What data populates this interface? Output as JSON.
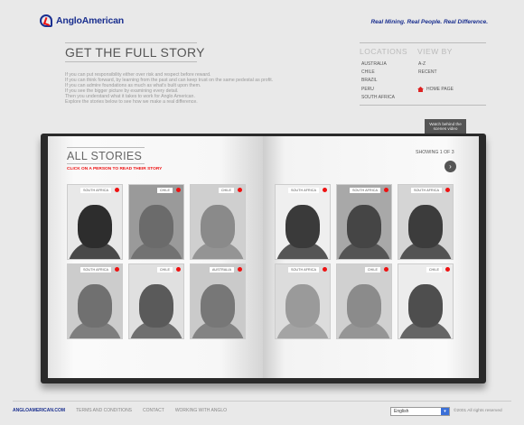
{
  "header": {
    "logo_text": "AngloAmerican",
    "tagline": "Real Mining. Real People. Real Difference."
  },
  "hero": {
    "title": "GET THE FULL STORY",
    "intro": [
      "If you can put responsibility either over risk and respect before reward.",
      "If you can think forward, by learning from the past and can keep trust on the same pedestal as profit.",
      "If you can admire foundations as much as what's built upon them.",
      "If you see the bigger picture by examining every detail.",
      "Then you understand what it takes to work for Anglo American.",
      "Explore the stories below to see how we make a real difference."
    ]
  },
  "nav": {
    "locations_label": "LOCATIONS",
    "locations": [
      "AUSTRALIA",
      "CHILE",
      "BRAZIL",
      "PERU",
      "SOUTH AFRICA"
    ],
    "view_by_label": "VIEW BY",
    "view_by": [
      "A-Z",
      "RECENT"
    ],
    "home_label": "HOME PAGE"
  },
  "video_button": "Watch behind the scenes video",
  "stories": {
    "title": "ALL STORIES",
    "hint": "CLICK ON A PERSON TO READ THEIR STORY",
    "showing": "SHOWING 1 OF 3",
    "next_symbol": "›",
    "people": [
      {
        "location": "SOUTH AFRICA",
        "skin": "#2d2d2d",
        "bg": "#e8e8e8"
      },
      {
        "location": "CHILE",
        "skin": "#6b6b6b",
        "bg": "#9a9a9a"
      },
      {
        "location": "CHILE",
        "skin": "#8a8a8a",
        "bg": "#cfcfcf"
      },
      {
        "location": "SOUTH AFRICA",
        "skin": "#3a3a3a",
        "bg": "#efefef"
      },
      {
        "location": "SOUTH AFRICA",
        "skin": "#454545",
        "bg": "#a8a8a8"
      },
      {
        "location": "SOUTH AFRICA",
        "skin": "#3c3c3c",
        "bg": "#d5d5d5"
      },
      {
        "location": "SOUTH AFRICA",
        "skin": "#707070",
        "bg": "#cccccc"
      },
      {
        "location": "CHILE",
        "skin": "#5a5a5a",
        "bg": "#e0e0e0"
      },
      {
        "location": "AUSTRALIA",
        "skin": "#777777",
        "bg": "#cacaca"
      },
      {
        "location": "SOUTH AFRICA",
        "skin": "#9a9a9a",
        "bg": "#dcdcdc"
      },
      {
        "location": "CHILE",
        "skin": "#8b8b8b",
        "bg": "#d0d0d0"
      },
      {
        "location": "CHILE",
        "skin": "#4e4e4e",
        "bg": "#ececec"
      }
    ]
  },
  "footer": {
    "links": [
      "ANGLOAMERICAN.COM",
      "TERMS AND CONDITIONS",
      "CONTACT",
      "WORKING WITH ANGLO"
    ],
    "language": "English",
    "copyright": "©2001 All rights reserved"
  },
  "colors": {
    "brand_blue": "#1a2f8f",
    "accent_red": "#e11111"
  }
}
